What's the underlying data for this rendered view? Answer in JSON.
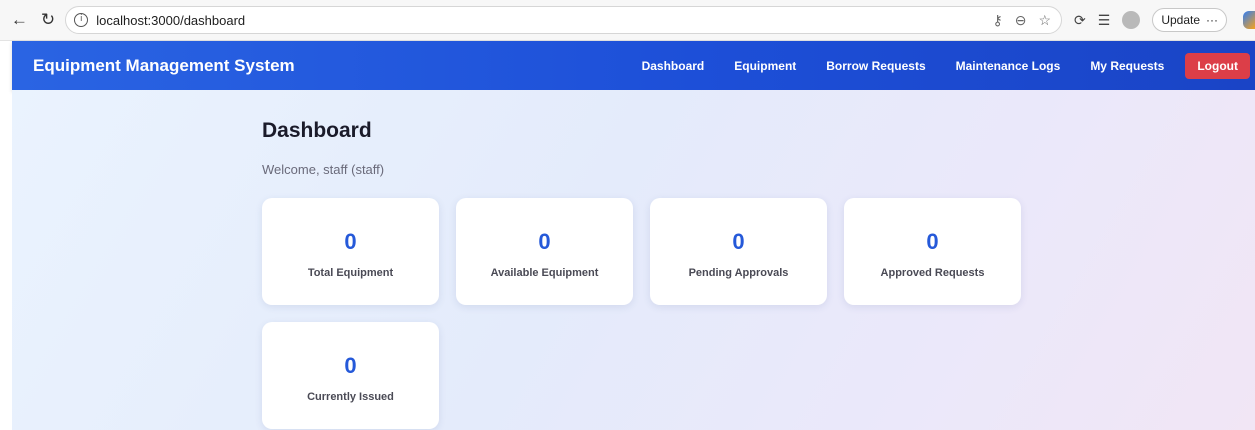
{
  "browser": {
    "url": "localhost:3000/dashboard",
    "update_label": "Update",
    "more_label": "···"
  },
  "header": {
    "title": "Equipment Management System",
    "nav": [
      "Dashboard",
      "Equipment",
      "Borrow Requests",
      "Maintenance Logs",
      "My Requests"
    ],
    "logout_label": "Logout",
    "logout_color": "#dc3e48",
    "brand_color": "#1d4fd8"
  },
  "main": {
    "title": "Dashboard",
    "welcome": "Welcome, staff (staff)",
    "stats": [
      {
        "value": "0",
        "label": "Total Equipment"
      },
      {
        "value": "0",
        "label": "Available Equipment"
      },
      {
        "value": "0",
        "label": "Pending Approvals"
      },
      {
        "value": "0",
        "label": "Approved Requests"
      },
      {
        "value": "0",
        "label": "Currently Issued"
      }
    ],
    "accent_color": "#2559d9"
  }
}
